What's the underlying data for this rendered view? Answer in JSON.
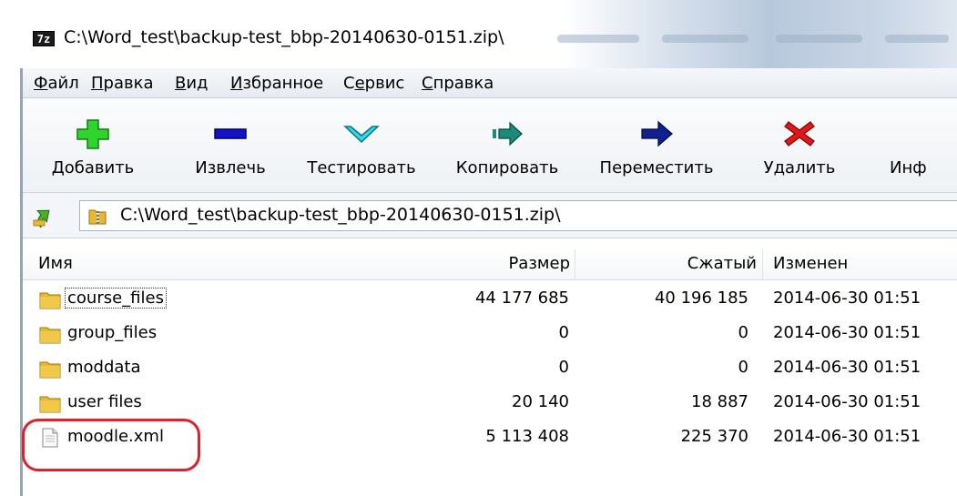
{
  "window": {
    "app_icon_text": "7z",
    "title": "C:\\Word_test\\backup-test_bbp-20140630-0151.zip\\"
  },
  "menu": [
    {
      "label": "Файл",
      "accel": "Ф"
    },
    {
      "label": "Правка",
      "accel": "П"
    },
    {
      "label": "Вид",
      "accel": "В"
    },
    {
      "label": "Избранное",
      "accel": "И"
    },
    {
      "label": "Сервис",
      "accel": "е"
    },
    {
      "label": "Справка",
      "accel": "С"
    }
  ],
  "toolbar": [
    {
      "label": "Добавить",
      "icon": "add-icon",
      "color": "#22cc22"
    },
    {
      "label": "Извлечь",
      "icon": "extract-icon",
      "color": "#1010c8"
    },
    {
      "label": "Тестировать",
      "icon": "test-icon",
      "color": "#28c8d8"
    },
    {
      "label": "Копировать",
      "icon": "copy-icon",
      "color": "#1a8a7a"
    },
    {
      "label": "Переместить",
      "icon": "move-icon",
      "color": "#102090"
    },
    {
      "label": "Удалить",
      "icon": "delete-icon",
      "color": "#e01010"
    },
    {
      "label": "Инф",
      "icon": "info-icon"
    }
  ],
  "address": {
    "path": "C:\\Word_test\\backup-test_bbp-20140630-0151.zip\\"
  },
  "columns": {
    "name": "Имя",
    "size": "Размер",
    "packed": "Сжатый",
    "modified": "Изменен"
  },
  "rows": [
    {
      "name": "course_files",
      "type": "folder",
      "size": "44 177 685",
      "packed": "40 196 185",
      "modified": "2014-06-30 01:51"
    },
    {
      "name": "group_files",
      "type": "folder",
      "size": "0",
      "packed": "0",
      "modified": "2014-06-30 01:51"
    },
    {
      "name": "moddata",
      "type": "folder",
      "size": "0",
      "packed": "0",
      "modified": "2014-06-30 01:51"
    },
    {
      "name": "user files",
      "type": "folder",
      "size": "20 140",
      "packed": "18 887",
      "modified": "2014-06-30 01:51"
    },
    {
      "name": "moodle.xml",
      "type": "file",
      "size": "5 113 408",
      "packed": "225 370",
      "modified": "2014-06-30 01:51"
    }
  ],
  "colors": {
    "highlight": "#e0202a",
    "folder": "#e8b830"
  }
}
